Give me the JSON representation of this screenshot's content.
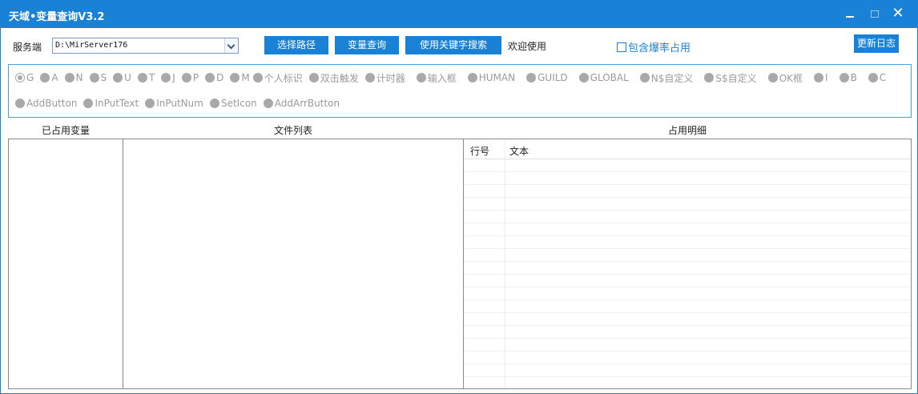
{
  "window": {
    "title": "天域•变量查询V3.2",
    "close_glyph": "✕"
  },
  "toolbar": {
    "server_label": "服务端",
    "server_path": "D:\\MirServer176",
    "select_path_button": "选择路径",
    "query_button": "变量查询",
    "keyword_search_button": "使用关键字搜索",
    "welcome_text": "欢迎使用",
    "include_drop_checkbox": "包含爆率占用",
    "include_drop_checked": false,
    "changelog_button": "更新日志"
  },
  "variable_types": {
    "row1": [
      "G",
      "A",
      "N",
      "S",
      "U",
      "T",
      "J",
      "P",
      "D",
      "M",
      "个人标识",
      "双击触发",
      "计时器",
      "输入框",
      "HUMAN",
      "GUILD",
      "GLOBAL",
      "N$自定义",
      "S$自定义",
      "OK框",
      "I",
      "B",
      "C"
    ],
    "row2": [
      "AddButton",
      "InPutText",
      "InPutNum",
      "SetIcon",
      "AddArrButton"
    ],
    "selected": "G"
  },
  "columns": {
    "used_variables": "已占用变量",
    "file_list": "文件列表",
    "usage_detail": "占用明细"
  },
  "detail_grid": {
    "col_line": "行号",
    "col_text": "文本"
  },
  "colors": {
    "accent": "#1a82d6",
    "disabled_text": "#9a9a9a"
  }
}
